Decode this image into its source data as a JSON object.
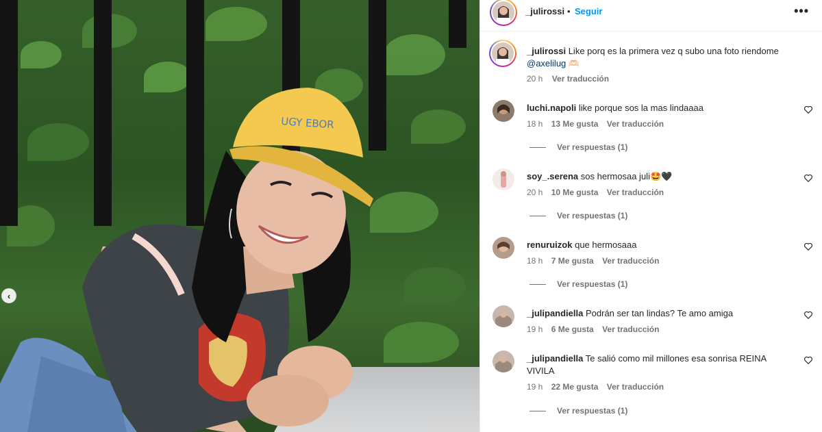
{
  "post": {
    "photo_alt": "Young woman in yellow cap smiling in front of hedge",
    "carousel_prev_icon": "chevron-left-icon"
  },
  "header": {
    "username": "_julirossi",
    "separator": "•",
    "follow_label": "Seguir",
    "more_icon": "more-horizontal-icon"
  },
  "caption": {
    "username": "_julirossi",
    "text": "Like porq es la primera vez q subo una foto riendome",
    "mention": "@axelilug",
    "emoji": "🫶🏻",
    "time": "20 h",
    "translate": "Ver traducción"
  },
  "comments": [
    {
      "username": "luchi.napoli",
      "text": "like porque sos la mas lindaaaa",
      "time": "18 h",
      "likes": "13 Me gusta",
      "translate": "Ver traducción",
      "replies": "Ver respuestas (1)"
    },
    {
      "username": "soy_.serena",
      "text": "sos hermosaa juli🤩🖤",
      "time": "20 h",
      "likes": "10 Me gusta",
      "translate": "Ver traducción",
      "replies": "Ver respuestas (1)"
    },
    {
      "username": "renuruizok",
      "text": "que hermosaaa",
      "time": "18 h",
      "likes": "7 Me gusta",
      "translate": "Ver traducción",
      "replies": "Ver respuestas (1)"
    },
    {
      "username": "_julipandiella",
      "text": "Podrán ser tan lindas? Te amo amiga",
      "time": "19 h",
      "likes": "6 Me gusta",
      "translate": "Ver traducción",
      "replies": ""
    },
    {
      "username": "_julipandiella",
      "text": "Te salió como mil millones esa sonrisa REINA VIVILA",
      "time": "19 h",
      "likes": "22 Me gusta",
      "translate": "Ver traducción",
      "replies": "Ver respuestas (1)"
    }
  ],
  "colors": {
    "accent": "#0095f6",
    "text": "#262626",
    "muted": "#737373",
    "mention": "#00376b"
  }
}
